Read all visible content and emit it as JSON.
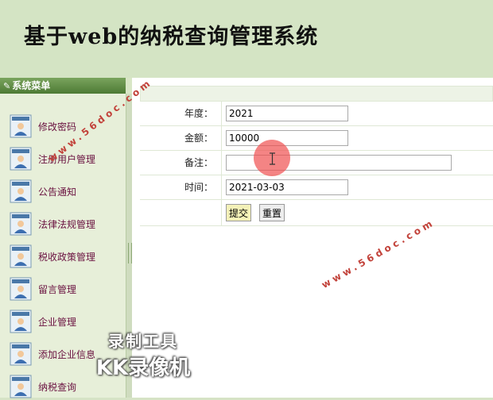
{
  "header": {
    "title": "基于web的纳税查询管理系统"
  },
  "sidebar": {
    "title": "系统菜单",
    "items": [
      {
        "label": "修改密码"
      },
      {
        "label": "注册用户管理"
      },
      {
        "label": "公告通知"
      },
      {
        "label": "法律法规管理"
      },
      {
        "label": "税收政策管理"
      },
      {
        "label": "留言管理"
      },
      {
        "label": "企业管理"
      },
      {
        "label": "添加企业信息"
      },
      {
        "label": "纳税查询"
      }
    ]
  },
  "form": {
    "year_label": "年度：",
    "year_value": "2021",
    "amount_label": "金额：",
    "amount_value": "10000",
    "note_label": "备注：",
    "note_value": "",
    "time_label": "时间：",
    "time_value": "2021-03-03",
    "submit_label": "提交",
    "reset_label": "重置"
  },
  "watermarks": {
    "site_1": "www.56doc.com",
    "site_2": "www.56doc.com",
    "recorder_line1": "录制工具",
    "recorder_line2": "KK录像机"
  },
  "colors": {
    "header_bg": "#d4e4c4",
    "menu_head": "#5b8a40",
    "menu_text": "#6a1140",
    "submit_bg": "#f4f1b8"
  }
}
